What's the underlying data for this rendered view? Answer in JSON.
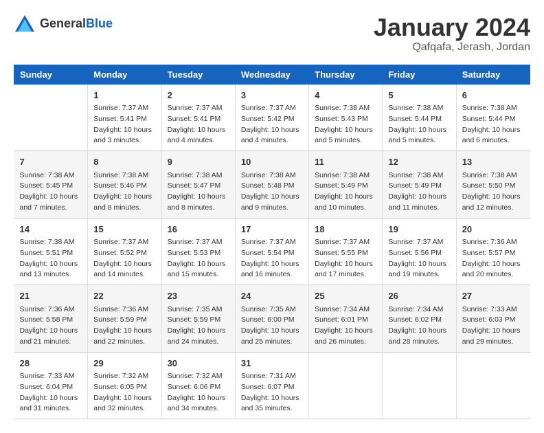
{
  "app": {
    "logo_general": "General",
    "logo_blue": "Blue",
    "title": "January 2024",
    "subtitle": "Qafqafa, Jerash, Jordan"
  },
  "calendar": {
    "headers": [
      "Sunday",
      "Monday",
      "Tuesday",
      "Wednesday",
      "Thursday",
      "Friday",
      "Saturday"
    ],
    "weeks": [
      [
        {
          "day": "",
          "info": ""
        },
        {
          "day": "1",
          "info": "Sunrise: 7:37 AM\nSunset: 5:41 PM\nDaylight: 10 hours\nand 3 minutes."
        },
        {
          "day": "2",
          "info": "Sunrise: 7:37 AM\nSunset: 5:41 PM\nDaylight: 10 hours\nand 4 minutes."
        },
        {
          "day": "3",
          "info": "Sunrise: 7:37 AM\nSunset: 5:42 PM\nDaylight: 10 hours\nand 4 minutes."
        },
        {
          "day": "4",
          "info": "Sunrise: 7:38 AM\nSunset: 5:43 PM\nDaylight: 10 hours\nand 5 minutes."
        },
        {
          "day": "5",
          "info": "Sunrise: 7:38 AM\nSunset: 5:44 PM\nDaylight: 10 hours\nand 5 minutes."
        },
        {
          "day": "6",
          "info": "Sunrise: 7:38 AM\nSunset: 5:44 PM\nDaylight: 10 hours\nand 6 minutes."
        }
      ],
      [
        {
          "day": "7",
          "info": "Sunrise: 7:38 AM\nSunset: 5:45 PM\nDaylight: 10 hours\nand 7 minutes."
        },
        {
          "day": "8",
          "info": "Sunrise: 7:38 AM\nSunset: 5:46 PM\nDaylight: 10 hours\nand 8 minutes."
        },
        {
          "day": "9",
          "info": "Sunrise: 7:38 AM\nSunset: 5:47 PM\nDaylight: 10 hours\nand 8 minutes."
        },
        {
          "day": "10",
          "info": "Sunrise: 7:38 AM\nSunset: 5:48 PM\nDaylight: 10 hours\nand 9 minutes."
        },
        {
          "day": "11",
          "info": "Sunrise: 7:38 AM\nSunset: 5:49 PM\nDaylight: 10 hours\nand 10 minutes."
        },
        {
          "day": "12",
          "info": "Sunrise: 7:38 AM\nSunset: 5:49 PM\nDaylight: 10 hours\nand 11 minutes."
        },
        {
          "day": "13",
          "info": "Sunrise: 7:38 AM\nSunset: 5:50 PM\nDaylight: 10 hours\nand 12 minutes."
        }
      ],
      [
        {
          "day": "14",
          "info": "Sunrise: 7:38 AM\nSunset: 5:51 PM\nDaylight: 10 hours\nand 13 minutes."
        },
        {
          "day": "15",
          "info": "Sunrise: 7:37 AM\nSunset: 5:52 PM\nDaylight: 10 hours\nand 14 minutes."
        },
        {
          "day": "16",
          "info": "Sunrise: 7:37 AM\nSunset: 5:53 PM\nDaylight: 10 hours\nand 15 minutes."
        },
        {
          "day": "17",
          "info": "Sunrise: 7:37 AM\nSunset: 5:54 PM\nDaylight: 10 hours\nand 16 minutes."
        },
        {
          "day": "18",
          "info": "Sunrise: 7:37 AM\nSunset: 5:55 PM\nDaylight: 10 hours\nand 17 minutes."
        },
        {
          "day": "19",
          "info": "Sunrise: 7:37 AM\nSunset: 5:56 PM\nDaylight: 10 hours\nand 19 minutes."
        },
        {
          "day": "20",
          "info": "Sunrise: 7:36 AM\nSunset: 5:57 PM\nDaylight: 10 hours\nand 20 minutes."
        }
      ],
      [
        {
          "day": "21",
          "info": "Sunrise: 7:36 AM\nSunset: 5:58 PM\nDaylight: 10 hours\nand 21 minutes."
        },
        {
          "day": "22",
          "info": "Sunrise: 7:36 AM\nSunset: 5:59 PM\nDaylight: 10 hours\nand 22 minutes."
        },
        {
          "day": "23",
          "info": "Sunrise: 7:35 AM\nSunset: 5:59 PM\nDaylight: 10 hours\nand 24 minutes."
        },
        {
          "day": "24",
          "info": "Sunrise: 7:35 AM\nSunset: 6:00 PM\nDaylight: 10 hours\nand 25 minutes."
        },
        {
          "day": "25",
          "info": "Sunrise: 7:34 AM\nSunset: 6:01 PM\nDaylight: 10 hours\nand 26 minutes."
        },
        {
          "day": "26",
          "info": "Sunrise: 7:34 AM\nSunset: 6:02 PM\nDaylight: 10 hours\nand 28 minutes."
        },
        {
          "day": "27",
          "info": "Sunrise: 7:33 AM\nSunset: 6:03 PM\nDaylight: 10 hours\nand 29 minutes."
        }
      ],
      [
        {
          "day": "28",
          "info": "Sunrise: 7:33 AM\nSunset: 6:04 PM\nDaylight: 10 hours\nand 31 minutes."
        },
        {
          "day": "29",
          "info": "Sunrise: 7:32 AM\nSunset: 6:05 PM\nDaylight: 10 hours\nand 32 minutes."
        },
        {
          "day": "30",
          "info": "Sunrise: 7:32 AM\nSunset: 6:06 PM\nDaylight: 10 hours\nand 34 minutes."
        },
        {
          "day": "31",
          "info": "Sunrise: 7:31 AM\nSunset: 6:07 PM\nDaylight: 10 hours\nand 35 minutes."
        },
        {
          "day": "",
          "info": ""
        },
        {
          "day": "",
          "info": ""
        },
        {
          "day": "",
          "info": ""
        }
      ]
    ]
  }
}
